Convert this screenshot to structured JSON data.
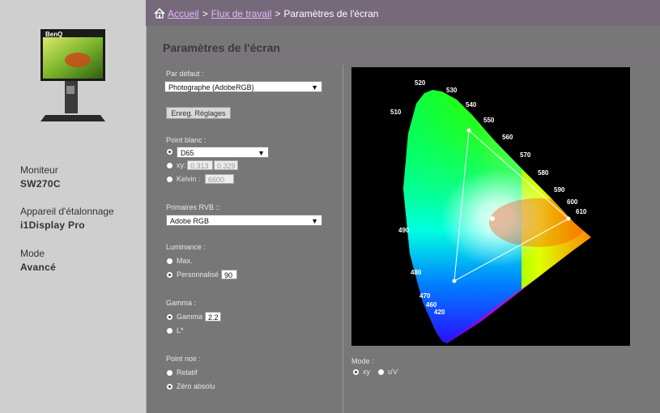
{
  "sidebar": {
    "monitor_label": "Moniteur",
    "monitor_value": "SW270C",
    "device_label": "Appareil d'étalonnage",
    "device_value": "i1Display Pro",
    "mode_label": "Mode",
    "mode_value": "Avancé",
    "brand_logo": "BenQ"
  },
  "breadcrumb": {
    "home": "Accueil",
    "workflow": "Flux de travail",
    "current": "Paramètres de l'écran",
    "separator": ">"
  },
  "page_title": "Paramètres de l'écran",
  "form": {
    "default_label": "Par défaut :",
    "default_value": "Photographe (AdobeRGB)",
    "save_button": "Enreg. Réglages",
    "white_point_label": "Point blanc :",
    "white_point_value": "D65",
    "xy_label": "xy:",
    "xy_x": "0.313",
    "xy_y": "0.329",
    "kelvin_label": "Kelvin :",
    "kelvin_value": "6600",
    "primaries_label": "Primaires RVB ::",
    "primaries_value": "Adobe RGB",
    "luminance_label": "Luminance :",
    "lum_max": "Max.",
    "lum_custom": "Personnalisé",
    "lum_value": "90",
    "gamma_label": "Gamma :",
    "gamma_option": "Gamma",
    "gamma_value": "2.2",
    "lstar_option": "L*",
    "black_label": "Point noir  :",
    "black_relative": "Relatif",
    "black_absolute": "Zéro absolu"
  },
  "chart": {
    "wavelengths": [
      "520",
      "530",
      "540",
      "550",
      "560",
      "570",
      "580",
      "590",
      "600",
      "610",
      "510",
      "490",
      "480",
      "470",
      "460",
      "420"
    ],
    "mode_label": "Mode :",
    "mode_xy": "xy",
    "mode_uv": "u'v'"
  },
  "icons": {
    "home": "home-icon",
    "chevron": "chevron-down-icon"
  }
}
